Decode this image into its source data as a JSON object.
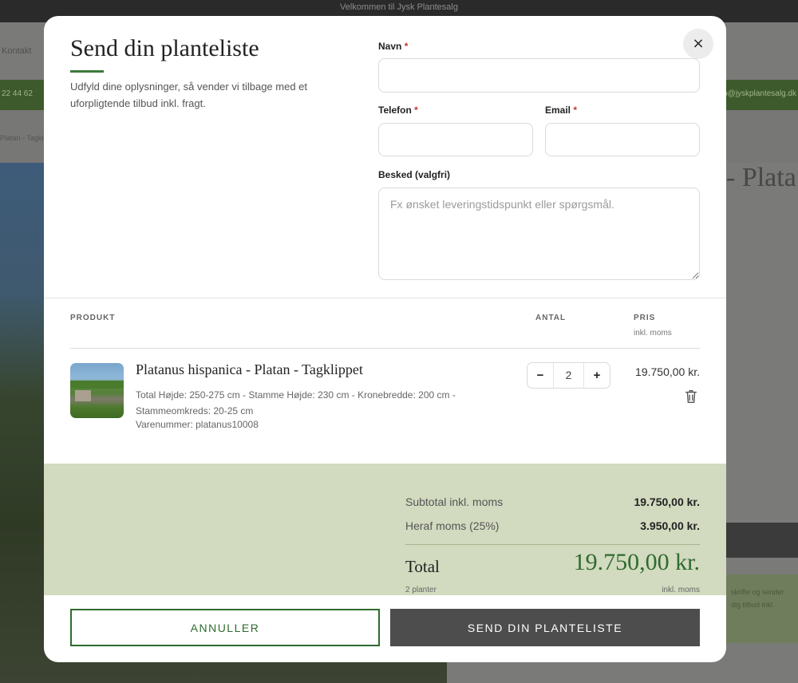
{
  "background": {
    "topbar_text": "Velkommen til Jysk Plantesalg",
    "nav_kontakt": "Kontakt",
    "green_left": "22 44 62",
    "green_right": "info@jyskplantesalg.dk",
    "crumb": "Platan - Tagklippet",
    "heading_fragment": "- Plata",
    "box_text": "skrifte og sender dig tilbud inkl."
  },
  "modal": {
    "close_glyph": "×",
    "title": "Send din planteliste",
    "intro": "Udfyld dine oplysninger, så vender vi tilbage med et uforpligtende tilbud inkl. fragt."
  },
  "form": {
    "name_label": "Navn",
    "phone_label": "Telefon",
    "email_label": "Email",
    "required_mark": "*",
    "message_label": "Besked (valgfri)",
    "message_placeholder": "Fx ønsket leveringstidspunkt eller spørgsmål.",
    "name_value": "",
    "phone_value": "",
    "email_value": ""
  },
  "table": {
    "col_product": "PRODUKT",
    "col_qty": "ANTAL",
    "col_price": "PRIS",
    "col_price_sub": "inkl. moms",
    "items": [
      {
        "name": "Platanus hispanica - Platan - Tagklippet",
        "spec": "Total Højde: 250-275 cm - Stamme Højde: 230 cm - Kronebredde: 200 cm - Stammeomkreds: 20-25 cm",
        "sku": "Varenummer: platanus10008",
        "qty": "2",
        "price": "19.750,00 kr.",
        "minus": "−",
        "plus": "+"
      }
    ]
  },
  "summary": {
    "subtotal_label": "Subtotal inkl. moms",
    "subtotal_value": "19.750,00 kr.",
    "vat_label": "Heraf moms (25%)",
    "vat_value": "3.950,00 kr.",
    "total_label": "Total",
    "total_value": "19.750,00 kr.",
    "plants_count": "2 planter",
    "incl_vat": "inkl. moms"
  },
  "actions": {
    "cancel": "ANNULLER",
    "send": "SEND DIN PLANTELISTE"
  },
  "colors": {
    "accent_green": "#2e6b2e",
    "summary_bg": "#d2dabf",
    "send_button": "#4d4d4d",
    "required": "#c0392b"
  }
}
